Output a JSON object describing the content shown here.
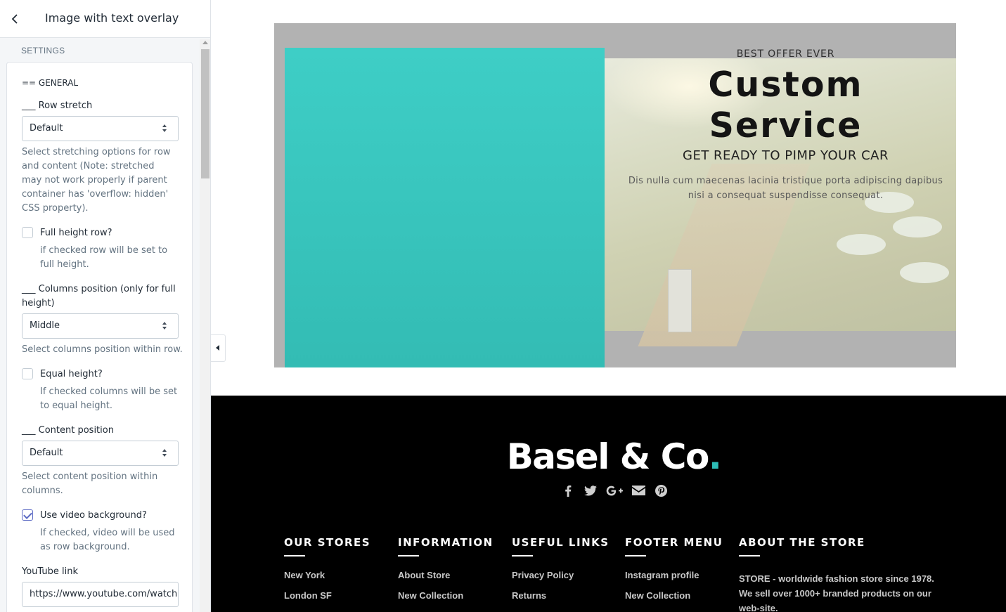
{
  "sidebar": {
    "title": "Image with text overlay",
    "section": "SETTINGS",
    "general_heading": "== GENERAL",
    "row_stretch": {
      "label": "___ Row stretch",
      "value": "Default",
      "help": "Select stretching options for row and content (Note: stretched may not work properly if parent container has 'overflow: hidden' CSS property)."
    },
    "full_height": {
      "label": "Full height row?",
      "checked": false,
      "help": "if checked row will be set to full height."
    },
    "columns_position": {
      "label": "___ Columns position (only for full height)",
      "value": "Middle",
      "help": "Select columns position within row."
    },
    "equal_height": {
      "label": "Equal height?",
      "checked": false,
      "help": "If checked columns will be set to equal height."
    },
    "content_position": {
      "label": "___ Content position",
      "value": "Default",
      "help": "Select content position within columns."
    },
    "video_background": {
      "label": "Use video background?",
      "checked": true,
      "help": "If checked, video will be used as row background."
    },
    "youtube": {
      "label": "YouTube link",
      "value": "https://www.youtube.com/watch"
    }
  },
  "banner": {
    "kicker": "BEST OFFER EVER",
    "title": "Custom Service",
    "subtitle": "GET READY TO PIMP YOUR CAR",
    "description": "Dis nulla cum maecenas lacinia tristique porta adipiscing dapibus nisi a consequat suspendisse consequat.",
    "accent_color": "#3ecec6"
  },
  "footer": {
    "logo_text": "Basel & Co",
    "logo_dot": ".",
    "logo_dot_color": "#2dbdb6",
    "socials": [
      "facebook-icon",
      "twitter-icon",
      "google-plus-icon",
      "envelope-icon",
      "pinterest-icon"
    ],
    "columns": [
      {
        "title": "OUR STORES",
        "links": [
          "New York",
          "London SF"
        ]
      },
      {
        "title": "INFORMATION",
        "links": [
          "About Store",
          "New Collection"
        ]
      },
      {
        "title": "USEFUL LINKS",
        "links": [
          "Privacy Policy",
          "Returns"
        ]
      },
      {
        "title": "FOOTER MENU",
        "links": [
          "Instagram profile",
          "New Collection"
        ]
      },
      {
        "title": "ABOUT THE STORE",
        "text": "STORE - worldwide fashion store since 1978. We sell over 1000+ branded products on our web-site."
      }
    ]
  }
}
